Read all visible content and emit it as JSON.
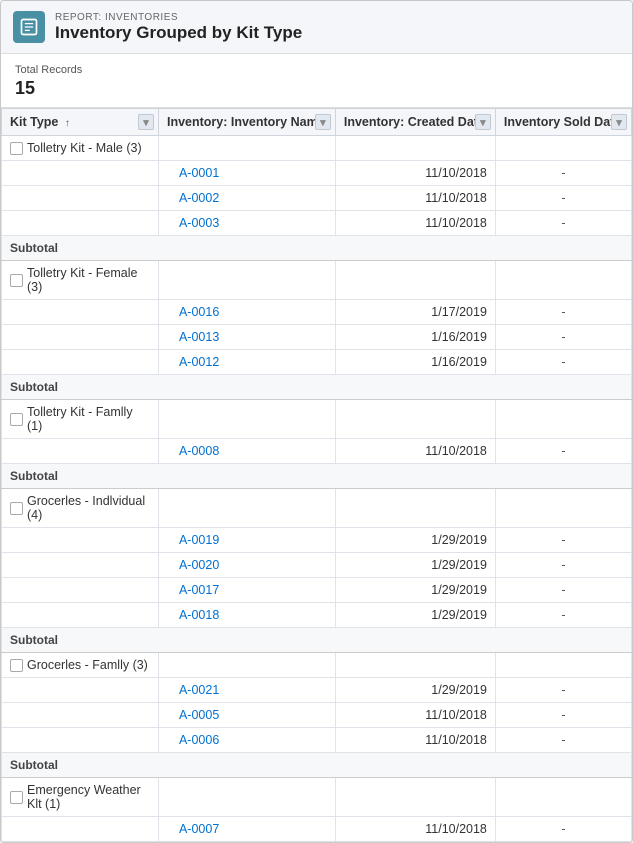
{
  "header": {
    "subtitle": "REPORT: INVENTORIES",
    "title": "Inventory Grouped by Kit Type",
    "icon_label": "report-icon"
  },
  "summary": {
    "label": "Total Records",
    "value": "15"
  },
  "table": {
    "columns": [
      {
        "id": "kittype",
        "label": "Kit Type",
        "sort": "↑"
      },
      {
        "id": "invname",
        "label": "Inventory: Inventory Name"
      },
      {
        "id": "createddate",
        "label": "Inventory: Created Date"
      },
      {
        "id": "solddate",
        "label": "Inventory Sold Date"
      }
    ],
    "groups": [
      {
        "name": "Tolletry Kit - Male (3)",
        "rows": [
          {
            "name": "A-0001",
            "created": "11/10/2018",
            "sold": "-"
          },
          {
            "name": "A-0002",
            "created": "11/10/2018",
            "sold": "-"
          },
          {
            "name": "A-0003",
            "created": "11/10/2018",
            "sold": "-"
          }
        ],
        "subtotal": "Subtotal"
      },
      {
        "name": "Tolletry Kit - Female (3)",
        "rows": [
          {
            "name": "A-0016",
            "created": "1/17/2019",
            "sold": "-"
          },
          {
            "name": "A-0013",
            "created": "1/16/2019",
            "sold": "-"
          },
          {
            "name": "A-0012",
            "created": "1/16/2019",
            "sold": "-"
          }
        ],
        "subtotal": "Subtotal"
      },
      {
        "name": "Tolletry Kit - Famlly (1)",
        "rows": [
          {
            "name": "A-0008",
            "created": "11/10/2018",
            "sold": "-"
          }
        ],
        "subtotal": "Subtotal"
      },
      {
        "name": "Grocerles - Indlvidual (4)",
        "rows": [
          {
            "name": "A-0019",
            "created": "1/29/2019",
            "sold": "-"
          },
          {
            "name": "A-0020",
            "created": "1/29/2019",
            "sold": "-"
          },
          {
            "name": "A-0017",
            "created": "1/29/2019",
            "sold": "-"
          },
          {
            "name": "A-0018",
            "created": "1/29/2019",
            "sold": "-"
          }
        ],
        "subtotal": "Subtotal"
      },
      {
        "name": "Grocerles - Famlly (3)",
        "rows": [
          {
            "name": "A-0021",
            "created": "1/29/2019",
            "sold": "-"
          },
          {
            "name": "A-0005",
            "created": "11/10/2018",
            "sold": "-"
          },
          {
            "name": "A-0006",
            "created": "11/10/2018",
            "sold": "-"
          }
        ],
        "subtotal": "Subtotal"
      },
      {
        "name": "Emergency Weather Klt (1)",
        "rows": [
          {
            "name": "A-0007",
            "created": "11/10/2018",
            "sold": "-"
          }
        ],
        "subtotal": null
      }
    ]
  }
}
